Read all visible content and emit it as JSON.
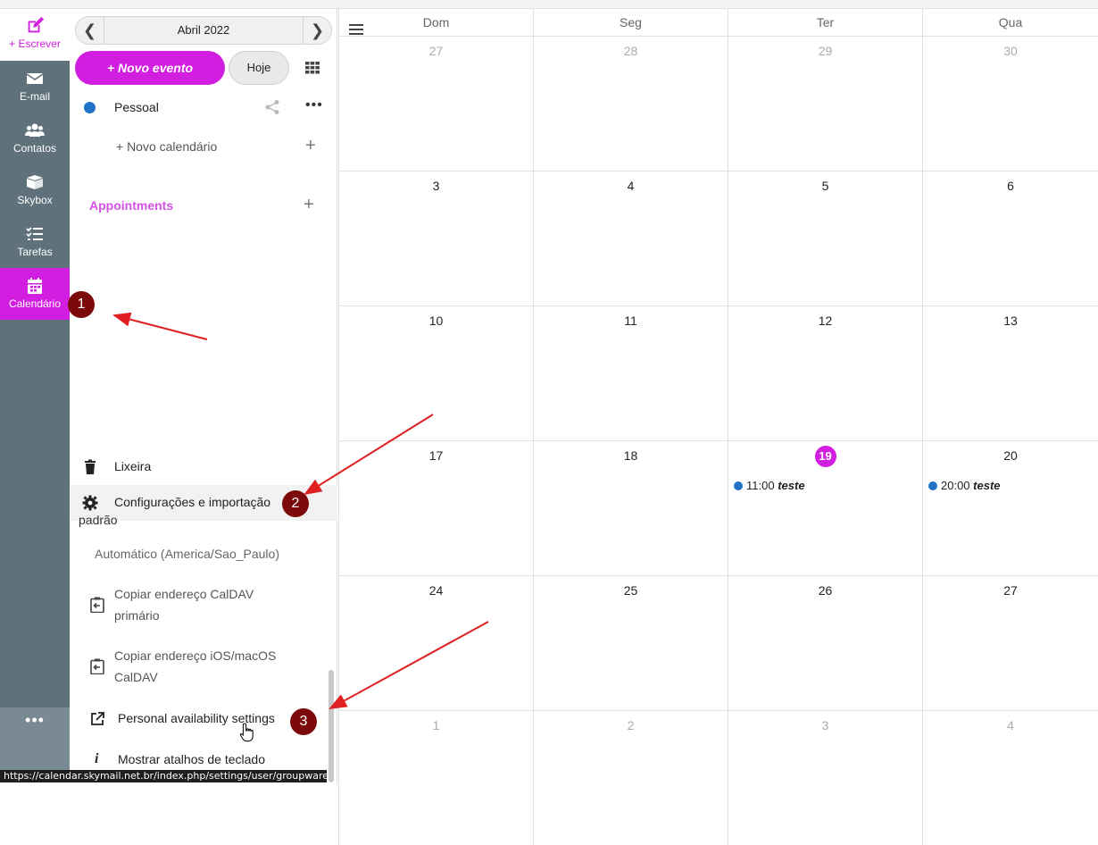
{
  "rail": {
    "compose": "+ Escrever",
    "items": [
      {
        "label": "E-mail",
        "icon": "envelope-icon"
      },
      {
        "label": "Contatos",
        "icon": "contacts-icon"
      },
      {
        "label": "Skybox",
        "icon": "box-icon"
      },
      {
        "label": "Tarefas",
        "icon": "tasks-icon"
      },
      {
        "label": "Calendário",
        "icon": "calendar-icon"
      }
    ],
    "more": "•••"
  },
  "sidebar": {
    "month": "Abril 2022",
    "new_event": "+ Novo evento",
    "today": "Hoje",
    "calendars": [
      {
        "name": "Pessoal",
        "color": "#1f72c5"
      }
    ],
    "new_calendar": "+ Novo calendário",
    "appointments": "Appointments",
    "trash": "Lixeira",
    "settings": "Configurações e importação",
    "padrao": "padrão",
    "timezone": "Automático (America/Sao_Paulo)",
    "copy_caldav_line1": "Copiar endereço CalDAV",
    "copy_caldav_line2": "primário",
    "copy_ios_line1": "Copiar endereço iOS/macOS",
    "copy_ios_line2": "CalDAV",
    "availability": "Personal availability settings",
    "shortcuts": "Mostrar atalhos de teclado"
  },
  "statusbar": "https://calendar.skymail.net.br/index.php/settings/user/groupware",
  "calendar": {
    "weekdays": [
      "Dom",
      "Seg",
      "Ter",
      "Qua"
    ],
    "weeks": [
      [
        {
          "d": "27",
          "other": true
        },
        {
          "d": "28",
          "other": true
        },
        {
          "d": "29",
          "other": true
        },
        {
          "d": "30",
          "other": true
        }
      ],
      [
        {
          "d": "3"
        },
        {
          "d": "4"
        },
        {
          "d": "5"
        },
        {
          "d": "6"
        }
      ],
      [
        {
          "d": "10"
        },
        {
          "d": "11"
        },
        {
          "d": "12"
        },
        {
          "d": "13"
        }
      ],
      [
        {
          "d": "17"
        },
        {
          "d": "18"
        },
        {
          "d": "19",
          "today": true,
          "event": {
            "time": "11:00",
            "title": "teste"
          }
        },
        {
          "d": "20",
          "event": {
            "time": "20:00",
            "title": "teste"
          }
        }
      ],
      [
        {
          "d": "24"
        },
        {
          "d": "25"
        },
        {
          "d": "26"
        },
        {
          "d": "27"
        }
      ],
      [
        {
          "d": "1",
          "other": true
        },
        {
          "d": "2",
          "other": true
        },
        {
          "d": "3",
          "other": true
        },
        {
          "d": "4",
          "other": true
        }
      ]
    ]
  },
  "annotations": {
    "b1": "1",
    "b2": "2",
    "b3": "3"
  },
  "colors": {
    "accent": "#d21ee0",
    "rail": "#5f717b",
    "event_dot": "#1f72c5",
    "badge": "#7c0a0a",
    "arrow": "#e02020"
  }
}
